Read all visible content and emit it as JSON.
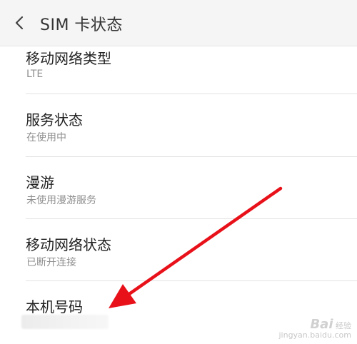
{
  "header": {
    "title": "SIM 卡状态"
  },
  "items": [
    {
      "label": "移动网络类型",
      "value": "LTE"
    },
    {
      "label": "服务状态",
      "value": "在使用中"
    },
    {
      "label": "漫游",
      "value": "未使用漫游服务"
    },
    {
      "label": "移动网络状态",
      "value": "已断开连接"
    },
    {
      "label": "本机号码",
      "value": ""
    }
  ],
  "watermark": {
    "brand": "Bai",
    "line1": "经验",
    "line2": "jingyan.baidu.com"
  },
  "colors": {
    "arrow": "#e8111a",
    "header_bg": "#f5f5f5",
    "secondary_text": "#8f8f8f"
  }
}
